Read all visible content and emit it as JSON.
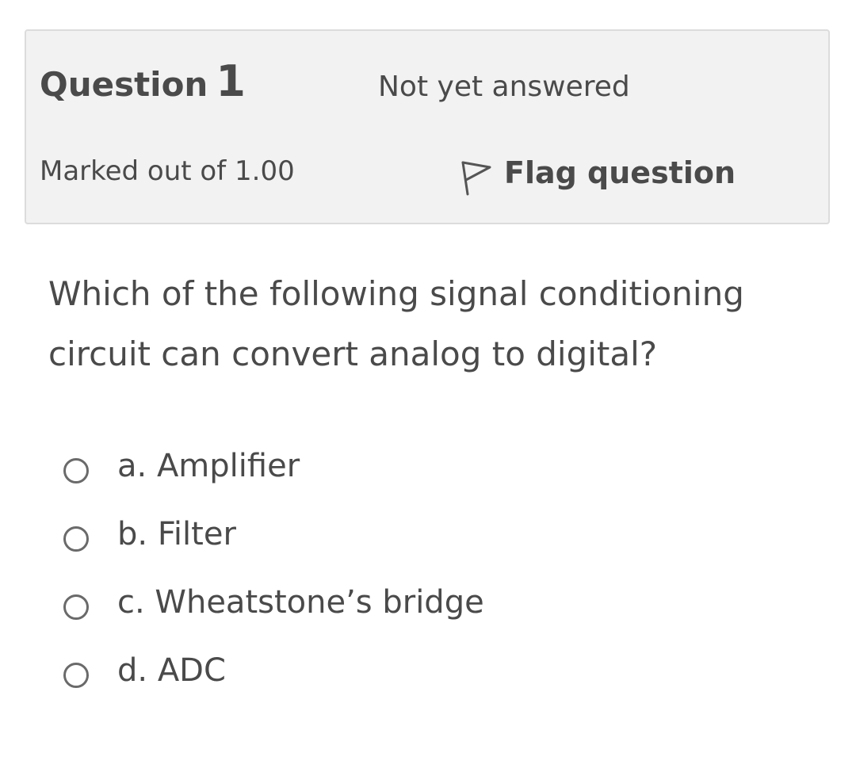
{
  "question_info": {
    "word": "Question",
    "number": "1",
    "state": "Not yet answered",
    "grade": "Marked out of 1.00",
    "flag_label": "Flag question",
    "flag_icon": "flag-outline-icon"
  },
  "question": {
    "text": "Which of the following signal conditioning circuit can convert analog to digital?"
  },
  "answers": [
    {
      "label": "a. Amplifier",
      "selected": false
    },
    {
      "label": "b. Filter",
      "selected": false
    },
    {
      "label": "c. Wheatstone’s bridge",
      "selected": false
    },
    {
      "label": "d. ADC",
      "selected": false
    }
  ],
  "colors": {
    "text": "#4a4a4a",
    "info_bg": "#f2f2f2",
    "info_border": "#dcdcdc"
  }
}
